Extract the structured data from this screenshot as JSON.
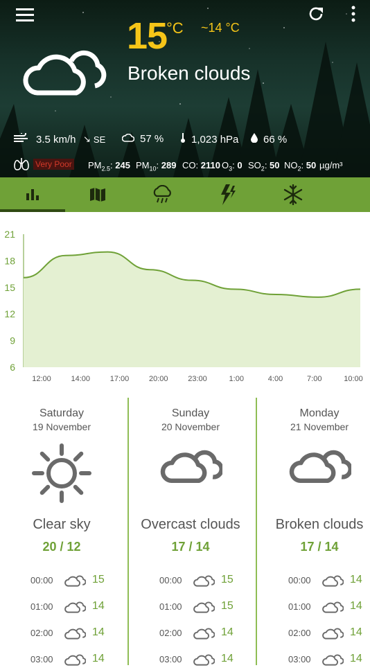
{
  "current": {
    "temp": "15",
    "unit": "°C",
    "feels_like": "~14 °C",
    "description": "Broken clouds",
    "wind": "3.5 km/h",
    "wind_dir": "SE",
    "clouds": "57 %",
    "pressure": "1,023 hPa",
    "humidity": "66 %"
  },
  "air": {
    "quality": "Very Poor",
    "pm25_label": "PM",
    "pm25_sub": "2.5",
    "pm25_value": "245",
    "pm10_label": "PM",
    "pm10_sub": "10",
    "pm10_value": "289",
    "co_label": "CO:",
    "co_value": "2110",
    "o3_label": "O",
    "o3_sub": "3",
    "o3_value": "0",
    "so2_label": "SO",
    "so2_sub": "2",
    "so2_value": "50",
    "no2_label": "NO",
    "no2_sub": "2",
    "no2_value": "50",
    "unit": "µg/m³"
  },
  "tabs": [
    "chart-icon",
    "map-icon",
    "rain-icon",
    "lightning-icon",
    "snowflake-icon"
  ],
  "colors": {
    "accent": "#6fa137",
    "temp": "#f5c518",
    "hero_bg": "#17322a"
  },
  "chart_data": {
    "type": "area",
    "x": [
      "12:00",
      "14:00",
      "17:00",
      "20:00",
      "23:00",
      "1:00",
      "4:00",
      "7:00",
      "10:00"
    ],
    "values": [
      16.1,
      18.6,
      19.0,
      17.0,
      15.8,
      14.8,
      14.2,
      13.9,
      14.8
    ],
    "ylim": [
      6,
      21
    ],
    "yticks": [
      "21",
      "18",
      "15",
      "12",
      "9",
      "6"
    ]
  },
  "days": [
    {
      "day": "Saturday",
      "date": "19 November",
      "icon": "sun-icon",
      "cond": "Clear sky",
      "range": "20 / 12",
      "hours": [
        {
          "t": "00:00",
          "v": "15"
        },
        {
          "t": "01:00",
          "v": "14"
        },
        {
          "t": "02:00",
          "v": "14"
        },
        {
          "t": "03:00",
          "v": "14"
        }
      ]
    },
    {
      "day": "Sunday",
      "date": "20 November",
      "icon": "clouds-icon",
      "cond": "Overcast clouds",
      "range": "17 / 14",
      "hours": [
        {
          "t": "00:00",
          "v": "15"
        },
        {
          "t": "01:00",
          "v": "15"
        },
        {
          "t": "02:00",
          "v": "14"
        },
        {
          "t": "03:00",
          "v": "14"
        }
      ]
    },
    {
      "day": "Monday",
      "date": "21 November",
      "icon": "clouds-icon",
      "cond": "Broken clouds",
      "range": "17 / 14",
      "hours": [
        {
          "t": "00:00",
          "v": "14"
        },
        {
          "t": "01:00",
          "v": "14"
        },
        {
          "t": "02:00",
          "v": "14"
        },
        {
          "t": "03:00",
          "v": "14"
        }
      ]
    }
  ]
}
